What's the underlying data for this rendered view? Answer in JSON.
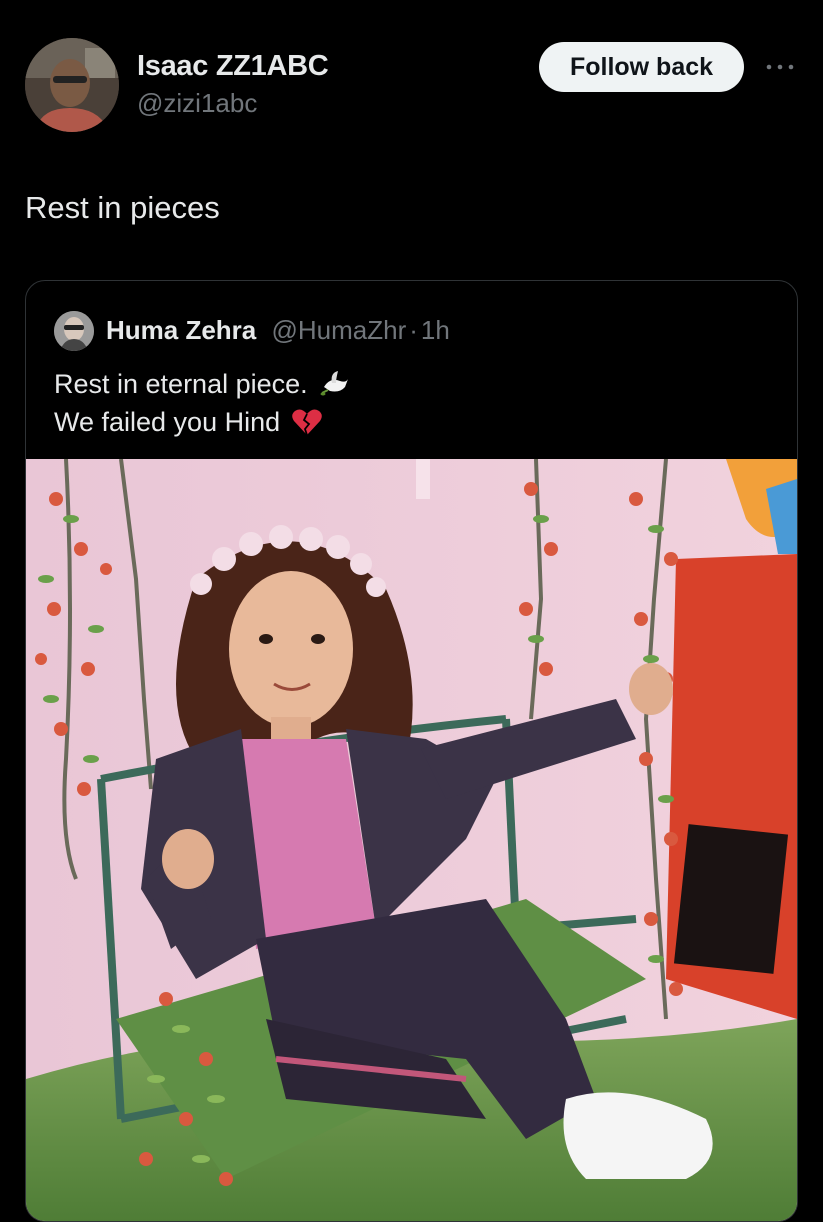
{
  "author": {
    "display_name": "Isaac ZZ1ABC",
    "handle": "@zizi1abc",
    "avatar_icon": "user-avatar-photo"
  },
  "actions": {
    "follow_label": "Follow back",
    "more_icon": "more-horizontal-icon"
  },
  "tweet": {
    "text": "Rest in pieces"
  },
  "quoted": {
    "display_name": "Huma Zehra",
    "handle": "@HumaZhr",
    "separator": "·",
    "time": "1h",
    "line1": "Rest in eternal piece.",
    "line1_emoji": "dove-icon",
    "line2": "We failed you Hind",
    "line2_emoji": "broken-heart-icon",
    "media": "photo of a smiling young girl in a dark tracksuit and flower crown sitting on a flower-decorated swing"
  },
  "colors": {
    "background": "#000000",
    "primary_text": "#e7e9ea",
    "secondary_text": "#71767b",
    "button_bg": "#eff3f4",
    "button_text": "#0f1419",
    "card_border": "#2f3336"
  }
}
